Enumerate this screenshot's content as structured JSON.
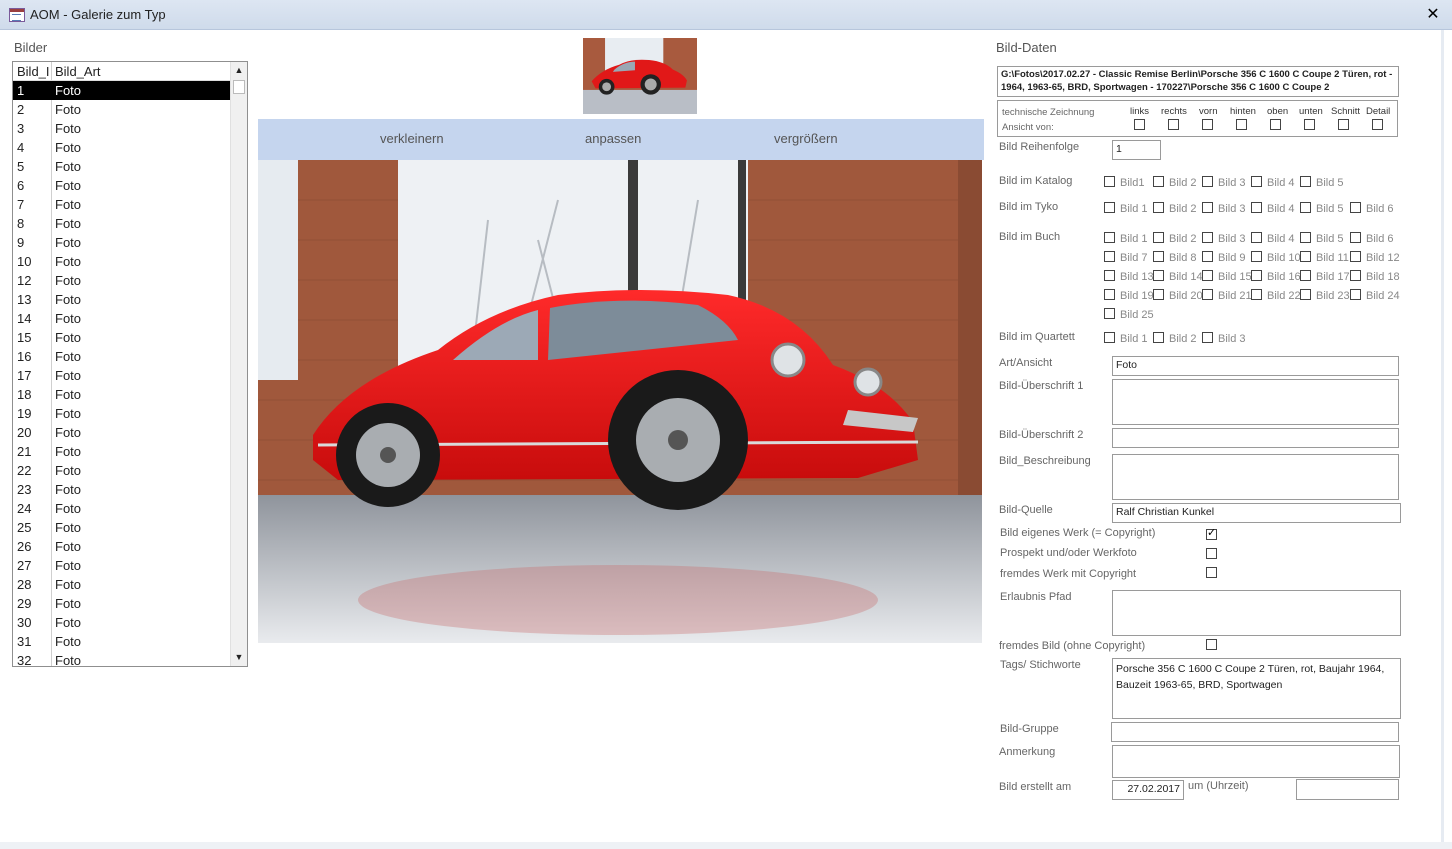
{
  "window": {
    "title": "AOM - Galerie zum Typ",
    "close_glyph": "✕"
  },
  "left": {
    "label": "Bilder",
    "columns": [
      "Bild_ID",
      "Bild_Art"
    ],
    "rows": [
      {
        "id": "1",
        "art": "Foto"
      },
      {
        "id": "2",
        "art": "Foto"
      },
      {
        "id": "3",
        "art": "Foto"
      },
      {
        "id": "4",
        "art": "Foto"
      },
      {
        "id": "5",
        "art": "Foto"
      },
      {
        "id": "6",
        "art": "Foto"
      },
      {
        "id": "7",
        "art": "Foto"
      },
      {
        "id": "8",
        "art": "Foto"
      },
      {
        "id": "9",
        "art": "Foto"
      },
      {
        "id": "10",
        "art": "Foto"
      },
      {
        "id": "12",
        "art": "Foto"
      },
      {
        "id": "13",
        "art": "Foto"
      },
      {
        "id": "14",
        "art": "Foto"
      },
      {
        "id": "15",
        "art": "Foto"
      },
      {
        "id": "16",
        "art": "Foto"
      },
      {
        "id": "17",
        "art": "Foto"
      },
      {
        "id": "18",
        "art": "Foto"
      },
      {
        "id": "19",
        "art": "Foto"
      },
      {
        "id": "20",
        "art": "Foto"
      },
      {
        "id": "21",
        "art": "Foto"
      },
      {
        "id": "22",
        "art": "Foto"
      },
      {
        "id": "23",
        "art": "Foto"
      },
      {
        "id": "24",
        "art": "Foto"
      },
      {
        "id": "25",
        "art": "Foto"
      },
      {
        "id": "26",
        "art": "Foto"
      },
      {
        "id": "27",
        "art": "Foto"
      },
      {
        "id": "28",
        "art": "Foto"
      },
      {
        "id": "29",
        "art": "Foto"
      },
      {
        "id": "30",
        "art": "Foto"
      },
      {
        "id": "31",
        "art": "Foto"
      },
      {
        "id": "32",
        "art": "Foto"
      }
    ],
    "selected_row": 0
  },
  "center": {
    "zoom_out": "verkleinern",
    "fit": "anpassen",
    "zoom_in": "vergrößern"
  },
  "right": {
    "label": "Bild-Daten",
    "path": "G:\\Fotos\\2017.02.27 - Classic Remise Berlin\\Porsche 356 C 1600 C Coupe 2 Türen, rot - 1964, 1963-65, BRD, Sportwagen - 170227\\Porsche 356 C 1600 C Coupe 2",
    "tz": {
      "line1": "technische Zeichnung",
      "line2": "Ansicht von:",
      "options": [
        "links",
        "rechts",
        "vorn",
        "hinten",
        "oben",
        "unten",
        "Schnitt",
        "Detail"
      ]
    },
    "reihenfolge": {
      "label": "Bild Reihenfolge",
      "value": "1"
    },
    "katalog": {
      "label": "Bild im Katalog",
      "options": [
        "Bild1",
        "Bild 2",
        "Bild 3",
        "Bild 4",
        "Bild 5"
      ]
    },
    "tyko": {
      "label": "Bild im Tyko",
      "options": [
        "Bild 1",
        "Bild 2",
        "Bild 3",
        "Bild 4",
        "Bild 5",
        "Bild 6"
      ]
    },
    "buch": {
      "label": "Bild im Buch",
      "options": [
        "Bild 1",
        "Bild 2",
        "Bild 3",
        "Bild 4",
        "Bild 5",
        "Bild 6",
        "Bild 7",
        "Bild 8",
        "Bild 9",
        "Bild 10",
        "Bild 11",
        "Bild 12",
        "Bild 13",
        "Bild 14",
        "Bild 15",
        "Bild 16",
        "Bild 17",
        "Bild 18",
        "Bild 19",
        "Bild 20",
        "Bild 21",
        "Bild 22",
        "Bild 23",
        "Bild 24",
        "Bild 25"
      ]
    },
    "quartett": {
      "label": "Bild im Quartett",
      "options": [
        "Bild 1",
        "Bild 2",
        "Bild 3"
      ]
    },
    "art": {
      "label": "Art/Ansicht",
      "value": "Foto"
    },
    "ueberschrift1": {
      "label": "Bild-Überschrift 1",
      "value": ""
    },
    "ueberschrift2": {
      "label": "Bild-Überschrift 2",
      "value": ""
    },
    "beschreibung": {
      "label": "Bild_Beschreibung",
      "value": ""
    },
    "quelle": {
      "label": "Bild-Quelle",
      "value": "Ralf Christian Kunkel"
    },
    "eigenes_werk": {
      "label": "Bild eigenes Werk (= Copyright)",
      "checked": true
    },
    "prospekt": {
      "label": "Prospekt und/oder Werkfoto",
      "checked": false
    },
    "fremdes_werk": {
      "label": "fremdes Werk mit Copyright",
      "checked": false
    },
    "erlaubnis": {
      "label": "Erlaubnis Pfad",
      "value": ""
    },
    "fremdes_bild": {
      "label": "fremdes Bild (ohne Copyright)",
      "checked": false
    },
    "tags": {
      "label": "Tags/ Stichworte",
      "value": "Porsche 356 C 1600 C Coupe 2 Türen, rot, Baujahr 1964, Bauzeit 1963-65, BRD, Sportwagen"
    },
    "gruppe": {
      "label": "Bild-Gruppe",
      "value": ""
    },
    "anmerkung": {
      "label": "Anmerkung",
      "value": ""
    },
    "erstellt": {
      "label": "Bild erstellt am",
      "value": "27.02.2017",
      "time_label": "um (Uhrzeit)",
      "time_value": ""
    }
  }
}
